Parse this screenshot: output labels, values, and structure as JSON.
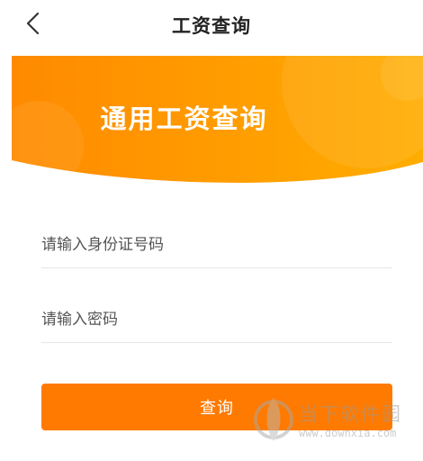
{
  "header": {
    "title": "工资查询"
  },
  "banner": {
    "title": "通用工资查询"
  },
  "form": {
    "id_placeholder": "请输入身份证号码",
    "id_value": "",
    "password_placeholder": "请输入密码",
    "password_value": "",
    "submit_label": "查询"
  },
  "watermark": {
    "name": "当下软件园",
    "url": "www.downxia.com"
  },
  "colors": {
    "accent": "#ff7a00",
    "banner_light": "#ffb300"
  }
}
